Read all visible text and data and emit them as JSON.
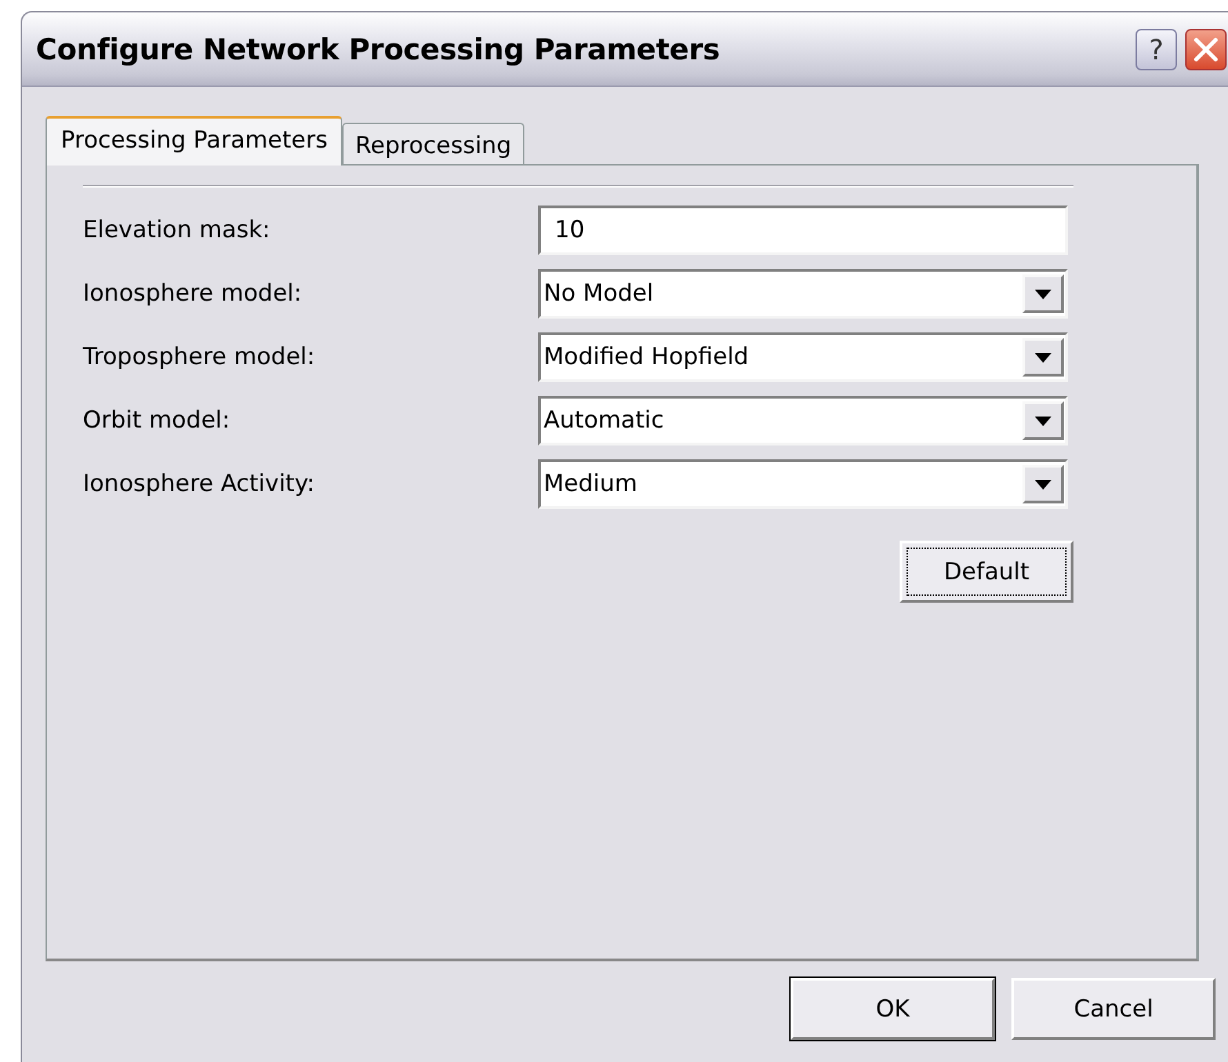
{
  "window": {
    "title": "Configure Network Processing Parameters",
    "help_label": "?"
  },
  "tabs": [
    {
      "label": "Processing Parameters",
      "selected": true
    },
    {
      "label": "Reprocessing",
      "selected": false
    }
  ],
  "fields": [
    {
      "label": "Elevation mask:",
      "kind": "text",
      "value": "10"
    },
    {
      "label": "Ionosphere model:",
      "kind": "dropdown",
      "value": "No Model"
    },
    {
      "label": "Troposphere model:",
      "kind": "dropdown",
      "value": "Modified Hopfield"
    },
    {
      "label": "Orbit model:",
      "kind": "dropdown",
      "value": "Automatic"
    },
    {
      "label": "Ionosphere Activity:",
      "kind": "dropdown",
      "value": "Medium"
    }
  ],
  "default_button": {
    "label": "Default",
    "focused": true
  },
  "buttons": [
    {
      "label": "OK",
      "default": true
    },
    {
      "label": "Cancel",
      "default": false
    }
  ]
}
